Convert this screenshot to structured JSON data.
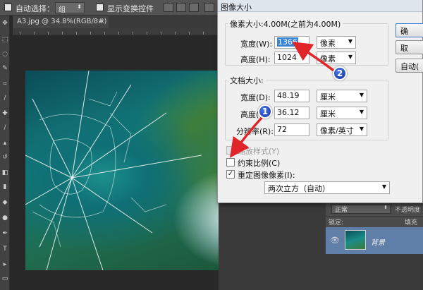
{
  "options_bar": {
    "auto_select_label": "自动选择：",
    "auto_select_value": "组",
    "show_transform_label": "显示变换控件"
  },
  "document_tab": {
    "title": "A3.jpg @ 34.8%(RGB/8#)",
    "close": "×"
  },
  "dialog": {
    "title": "图像大小",
    "pixel_dimensions": {
      "label": "像素大小:4.00M(之前为4.00M)",
      "width_label": "宽度(W):",
      "width_value": "1366",
      "width_unit": "像素",
      "height_label": "高度(H):",
      "height_value": "1024",
      "height_unit": "像素"
    },
    "document_size": {
      "label": "文档大小:",
      "width_label": "宽度(D):",
      "width_value": "48.19",
      "width_unit": "厘米",
      "height_label": "高度(G):",
      "height_value": "36.12",
      "height_unit": "厘米",
      "resolution_label": "分辨率(R):",
      "resolution_value": "72",
      "resolution_unit": "像素/英寸"
    },
    "scale_styles_label": "缩放样式(Y)",
    "constrain_label": "约束比例(C)",
    "resample_label": "重定图像像素(I):",
    "resample_method": "两次立方（自动）",
    "buttons": {
      "ok": "确",
      "cancel": "取",
      "auto": "自动("
    }
  },
  "callouts": {
    "one": "1",
    "two": "2"
  },
  "layers": {
    "blend_mode": "正常",
    "opacity_label": "不透明度",
    "lock_label": "锁定:",
    "fill_label": "填充",
    "layer_name": "背景"
  },
  "colors": {
    "callout_blue": "#2a52c8",
    "arrow_red": "#e0252b",
    "selection_blue": "#3a84d6"
  }
}
